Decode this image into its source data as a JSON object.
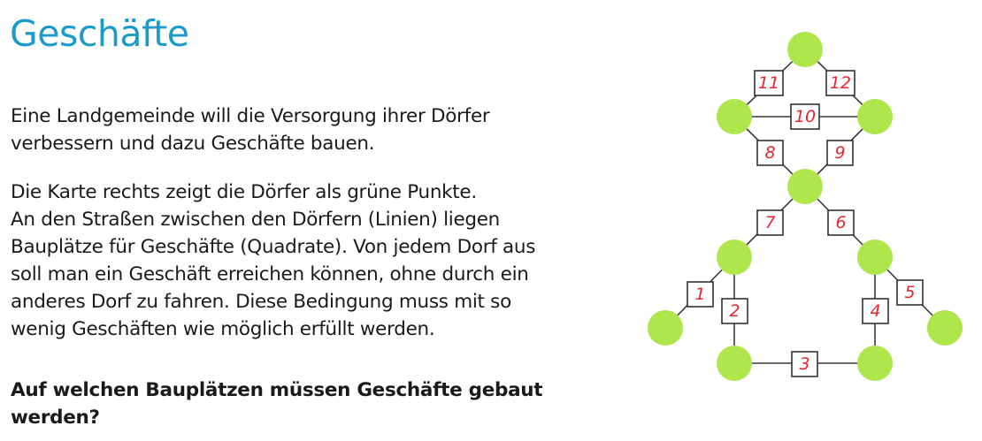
{
  "title": "Geschäfte",
  "paragraph1": [
    "Eine Landgemeinde will die Versorgung ihrer Dörfer",
    "verbessern und dazu Geschäfte bauen."
  ],
  "paragraph2": [
    "Die Karte rechts zeigt die Dörfer als grüne Punkte.",
    "An den Straßen zwischen den Dörfern (Linien) liegen",
    "Bauplätze für Geschäfte (Quadrate). Von jedem Dorf aus",
    "soll man ein Geschäft erreichen können, ohne durch ein",
    "anderes Dorf zu fahren. Diese Bedingung muss mit so",
    "wenig Geschäften wie möglich erfüllt werden."
  ],
  "question": [
    "Auf welchen Bauplätzen müssen Geschäfte gebaut",
    "werden?"
  ],
  "colors": {
    "title": "#1a9bc9",
    "village": "#aee64b",
    "lot_number": "#e8262f"
  },
  "map": {
    "lots": [
      "1",
      "2",
      "3",
      "4",
      "5",
      "6",
      "7",
      "8",
      "9",
      "10",
      "11",
      "12"
    ]
  }
}
